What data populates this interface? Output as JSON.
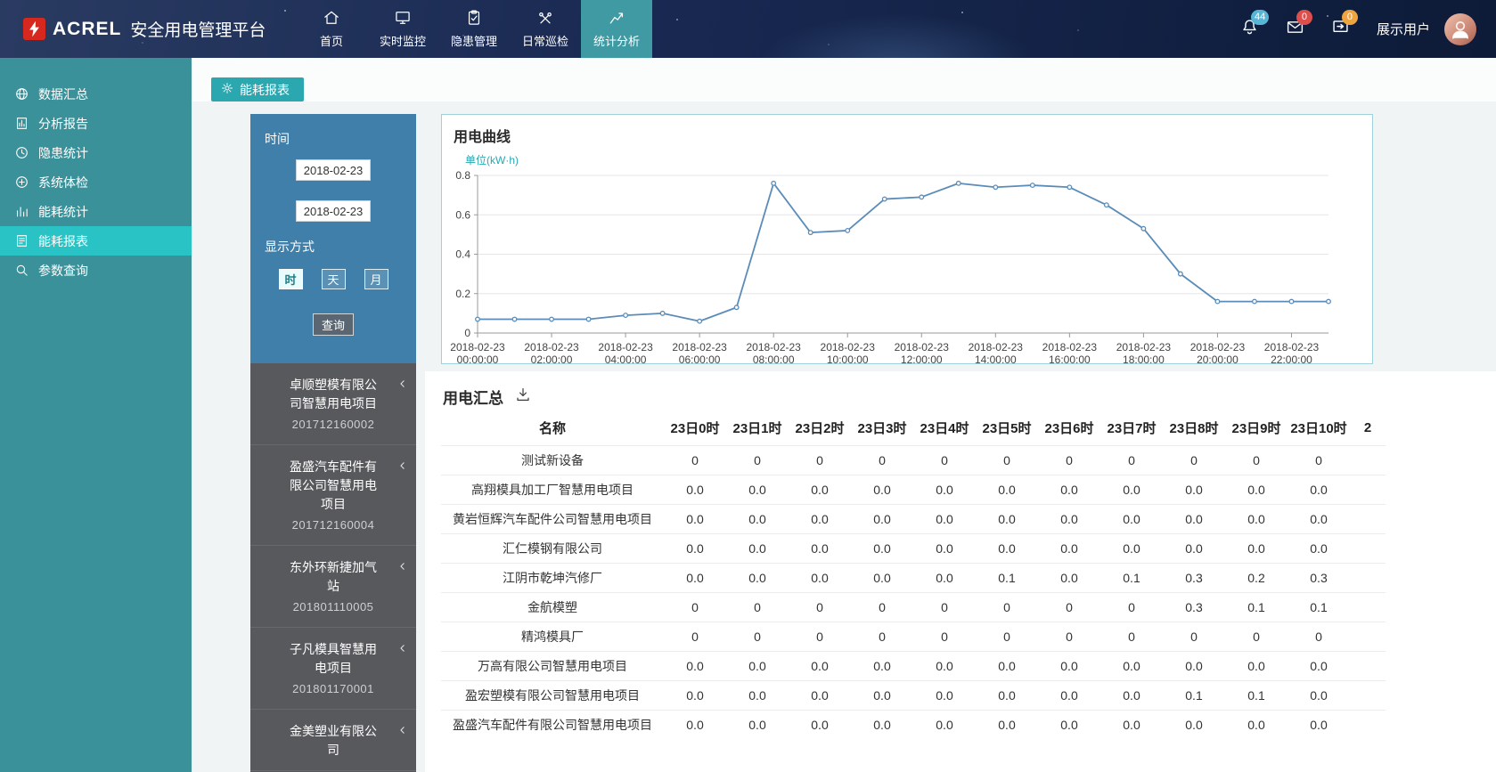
{
  "header": {
    "logo_text": "ACREL",
    "title": "安全用电管理平台",
    "nav": [
      {
        "key": "home",
        "label": "首页",
        "icon": "home",
        "active": false
      },
      {
        "key": "realtime-monitor",
        "label": "实时监控",
        "icon": "monitor",
        "active": false
      },
      {
        "key": "hazard-management",
        "label": "隐患管理",
        "icon": "clipboard",
        "active": false
      },
      {
        "key": "daily-inspection",
        "label": "日常巡检",
        "icon": "tools",
        "active": false
      },
      {
        "key": "statistics-analysis",
        "label": "统计分析",
        "icon": "stats",
        "active": true
      }
    ],
    "badges": {
      "bell": "44",
      "mail": "0",
      "screen": "0"
    },
    "user_label": "展示用户"
  },
  "sidebar": {
    "items": [
      {
        "key": "data-summary",
        "label": "数据汇总",
        "icon": "globe",
        "active": false
      },
      {
        "key": "analysis-report",
        "label": "分析报告",
        "icon": "report",
        "active": false
      },
      {
        "key": "hazard-statistics",
        "label": "隐患统计",
        "icon": "clock",
        "active": false
      },
      {
        "key": "system-checkup",
        "label": "系统体检",
        "icon": "checkup",
        "active": false
      },
      {
        "key": "energy-statistics",
        "label": "能耗统计",
        "icon": "bars",
        "active": false
      },
      {
        "key": "energy-report",
        "label": "能耗报表",
        "icon": "doc",
        "active": true
      },
      {
        "key": "parameter-query",
        "label": "参数查询",
        "icon": "search",
        "active": false
      }
    ]
  },
  "page": {
    "tab_title": "能耗报表"
  },
  "filter_panel": {
    "time_label": "时间",
    "date_from": "2018-02-23",
    "date_to": "2018-02-23",
    "display_mode_label": "显示方式",
    "mode_buttons": [
      {
        "key": "hour",
        "label": "时",
        "active": true
      },
      {
        "key": "day",
        "label": "天",
        "active": false
      },
      {
        "key": "month",
        "label": "月",
        "active": false
      }
    ],
    "query_label": "查询"
  },
  "project_list": [
    {
      "name": "卓顺塑模有限公司智慧用电项目",
      "code": "201712160002"
    },
    {
      "name": "盈盛汽车配件有限公司智慧用电项目",
      "code": "201712160004"
    },
    {
      "name": "东外环新捷加气站",
      "code": "201801110005"
    },
    {
      "name": "子凡模具智慧用电项目",
      "code": "201801170001"
    },
    {
      "name": "金美塑业有限公司",
      "code": ""
    }
  ],
  "chart_data": {
    "type": "line",
    "title": "用电曲线",
    "unit_label": "单位(kW·h)",
    "date": "2018-02-23",
    "x": [
      "00:00:00",
      "01:00:00",
      "02:00:00",
      "03:00:00",
      "04:00:00",
      "05:00:00",
      "06:00:00",
      "07:00:00",
      "08:00:00",
      "09:00:00",
      "10:00:00",
      "11:00:00",
      "12:00:00",
      "13:00:00",
      "14:00:00",
      "15:00:00",
      "16:00:00",
      "17:00:00",
      "18:00:00",
      "19:00:00",
      "20:00:00",
      "21:00:00",
      "22:00:00",
      "23:00:00"
    ],
    "x_tick_every": 2,
    "values": [
      0.07,
      0.07,
      0.07,
      0.07,
      0.09,
      0.1,
      0.06,
      0.13,
      0.76,
      0.51,
      0.52,
      0.68,
      0.69,
      0.76,
      0.74,
      0.75,
      0.74,
      0.65,
      0.53,
      0.3,
      0.16,
      0.16,
      0.16,
      0.16
    ],
    "ylim": [
      0,
      0.8
    ],
    "y_ticks": [
      0,
      0.2,
      0.4,
      0.6,
      0.8
    ],
    "line_color": "#5b8cb8",
    "grid": true,
    "legend": false
  },
  "summary": {
    "title": "用电汇总",
    "columns": [
      "名称",
      "23日0时",
      "23日1时",
      "23日2时",
      "23日3时",
      "23日4时",
      "23日5时",
      "23日6时",
      "23日7时",
      "23日8时",
      "23日9时",
      "23日10时",
      "2"
    ],
    "rows": [
      {
        "name": "测试新设备",
        "values": [
          "0",
          "0",
          "0",
          "0",
          "0",
          "0",
          "0",
          "0",
          "0",
          "0",
          "0"
        ]
      },
      {
        "name": "高翔模具加工厂智慧用电项目",
        "values": [
          "0.0",
          "0.0",
          "0.0",
          "0.0",
          "0.0",
          "0.0",
          "0.0",
          "0.0",
          "0.0",
          "0.0",
          "0.0"
        ]
      },
      {
        "name": "黄岩恒辉汽车配件公司智慧用电项目",
        "values": [
          "0.0",
          "0.0",
          "0.0",
          "0.0",
          "0.0",
          "0.0",
          "0.0",
          "0.0",
          "0.0",
          "0.0",
          "0.0"
        ]
      },
      {
        "name": "汇仁模钢有限公司",
        "values": [
          "0.0",
          "0.0",
          "0.0",
          "0.0",
          "0.0",
          "0.0",
          "0.0",
          "0.0",
          "0.0",
          "0.0",
          "0.0"
        ]
      },
      {
        "name": "江阴市乾坤汽修厂",
        "values": [
          "0.0",
          "0.0",
          "0.0",
          "0.0",
          "0.0",
          "0.1",
          "0.0",
          "0.1",
          "0.3",
          "0.2",
          "0.3"
        ]
      },
      {
        "name": "金航模塑",
        "values": [
          "0",
          "0",
          "0",
          "0",
          "0",
          "0",
          "0",
          "0",
          "0.3",
          "0.1",
          "0.1"
        ]
      },
      {
        "name": "精鸿模具厂",
        "values": [
          "0",
          "0",
          "0",
          "0",
          "0",
          "0",
          "0",
          "0",
          "0",
          "0",
          "0"
        ]
      },
      {
        "name": "万高有限公司智慧用电项目",
        "values": [
          "0.0",
          "0.0",
          "0.0",
          "0.0",
          "0.0",
          "0.0",
          "0.0",
          "0.0",
          "0.0",
          "0.0",
          "0.0"
        ]
      },
      {
        "name": "盈宏塑模有限公司智慧用电项目",
        "values": [
          "0.0",
          "0.0",
          "0.0",
          "0.0",
          "0.0",
          "0.0",
          "0.0",
          "0.0",
          "0.1",
          "0.1",
          "0.0"
        ]
      },
      {
        "name": "盈盛汽车配件有限公司智慧用电项目",
        "values": [
          "0.0",
          "0.0",
          "0.0",
          "0.0",
          "0.0",
          "0.0",
          "0.0",
          "0.0",
          "0.0",
          "0.0",
          "0.0"
        ]
      }
    ]
  },
  "colors": {
    "accent_teal": "#2ba7b0",
    "sidebar": "#3b919a",
    "sidebar_active": "#29c3c5",
    "filter_panel": "#3f7fa9",
    "list_panel": "#58595c",
    "chart_line": "#5b8cb8",
    "badge_blue": "#57b6d5",
    "badge_red": "#dd4f4c",
    "badge_yellow": "#eda53f"
  }
}
